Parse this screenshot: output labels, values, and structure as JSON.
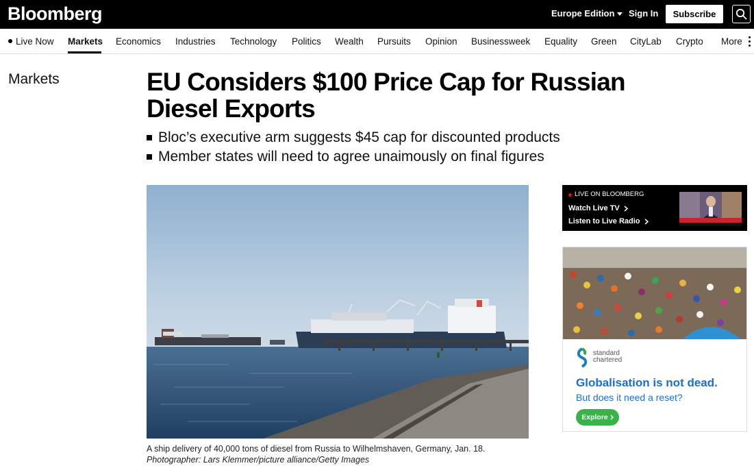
{
  "topbar": {
    "logo": "Bloomberg",
    "edition": "Europe Edition",
    "sign_in": "Sign In",
    "subscribe": "Subscribe"
  },
  "nav": {
    "items": [
      "Live Now",
      "Markets",
      "Economics",
      "Industries",
      "Technology",
      "Politics",
      "Wealth",
      "Pursuits",
      "Opinion",
      "Businessweek",
      "Equality",
      "Green",
      "CityLab",
      "Crypto",
      "More"
    ],
    "active": "Markets"
  },
  "article": {
    "section": "Markets",
    "headline_line1": "EU Considers $100 Price Cap for Russian",
    "headline_line2": "Diesel Exports",
    "bullets": [
      "Bloc’s executive arm suggests $45 cap for discounted products",
      "Member states will need to agree unaimously on final figures"
    ],
    "caption": "A ship delivery of 40,000 tons of diesel from Russia to Wilhelmshaven, Germany, Jan. 18.",
    "credit": "Photographer: Lars Klemmer/picture alliance/Getty Images"
  },
  "live": {
    "label": "LIVE ON BLOOMBERG",
    "tv": "Watch Live TV",
    "radio": "Listen to Live Radio"
  },
  "ad": {
    "brand_line1": "standard",
    "brand_line2": "chartered",
    "headline": "Globalisation is not dead.",
    "subhead": "But does it need a reset?",
    "cta": "Explore"
  },
  "colors": {
    "topbar_bg": "#000000",
    "live_red": "#e3120b",
    "ad_blue": "#1a6fd6",
    "ad_green": "#37b34a"
  }
}
